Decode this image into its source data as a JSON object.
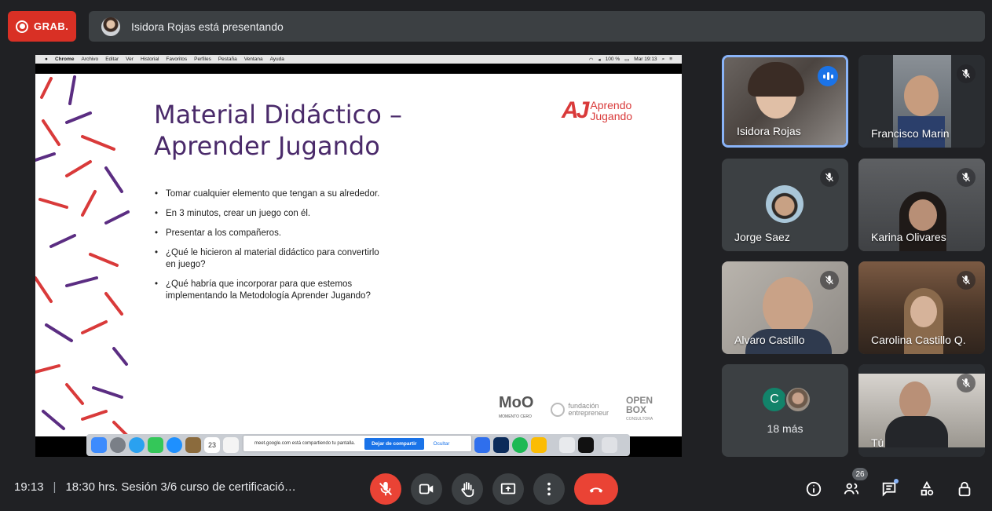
{
  "recording": {
    "label": "GRAB."
  },
  "presenting": {
    "text": "Isidora Rojas está presentando"
  },
  "mac_menubar": {
    "apple": "",
    "items": [
      "Chrome",
      "Archivo",
      "Editar",
      "Ver",
      "Historial",
      "Favoritos",
      "Perfiles",
      "Pestaña",
      "Ventana",
      "Ayuda"
    ],
    "battery": "100 %",
    "clock": "Mar 19:13"
  },
  "slide": {
    "title_line1": "Material Didáctico –",
    "title_line2": "Aprender Jugando",
    "logo_mark": "AJ",
    "logo_line1": "Aprendo",
    "logo_line2": "Jugando",
    "bullets": [
      "Tomar cualquier elemento que tengan a su alrededor.",
      "En 3 minutos, crear un juego con él.",
      "Presentar a los compañeros.",
      "¿Qué le hicieron al material didáctico para convertirlo en juego?",
      "¿Qué habría que incorporar para que estemos implementando la Metodología Aprender Jugando?"
    ],
    "sponsor_moo": "MoO",
    "sponsor_moo_sub": "MOMENTO CERO",
    "sponsor_fund_1": "fundación",
    "sponsor_fund_2": "entrepreneur",
    "sponsor_open_1": "OPEN",
    "sponsor_open_2": "BOX",
    "sponsor_open_sub": "CONSULTORA"
  },
  "dock": {
    "calendar_day": "23",
    "share_text": "meet.google.com está compartiendo tu pantalla.",
    "stop_label": "Dejar de compartir",
    "hide_label": "Ocultar"
  },
  "participants": [
    {
      "name": "Isidora Rojas",
      "speaking": true
    },
    {
      "name": "Francisco Marin",
      "muted": true
    },
    {
      "name": "Jorge Saez",
      "muted": true
    },
    {
      "name": "Karina Olivares",
      "muted": true
    },
    {
      "name": "Alvaro Castillo",
      "muted": true
    },
    {
      "name": "Carolina Castillo Q.",
      "muted": true
    },
    {
      "more_initial": "C",
      "more_label": "18 más"
    },
    {
      "name": "Tú",
      "muted": true
    }
  ],
  "bottom": {
    "time": "19:13",
    "meeting_title": "18:30 hrs. Sesión 3/6 curso de certificació…",
    "participant_count": "26"
  },
  "colors": {
    "accent": "#8ab4f8",
    "danger": "#ea4335",
    "surface": "#3c4043",
    "slide_title": "#4a2a6a",
    "brand_red": "#d93a3a"
  },
  "icons": [
    "record-icon",
    "mic-off-icon",
    "camera-icon",
    "raise-hand-icon",
    "present-icon",
    "more-icon",
    "end-call-icon",
    "info-icon",
    "people-icon",
    "chat-icon",
    "activities-icon",
    "host-controls-icon"
  ]
}
